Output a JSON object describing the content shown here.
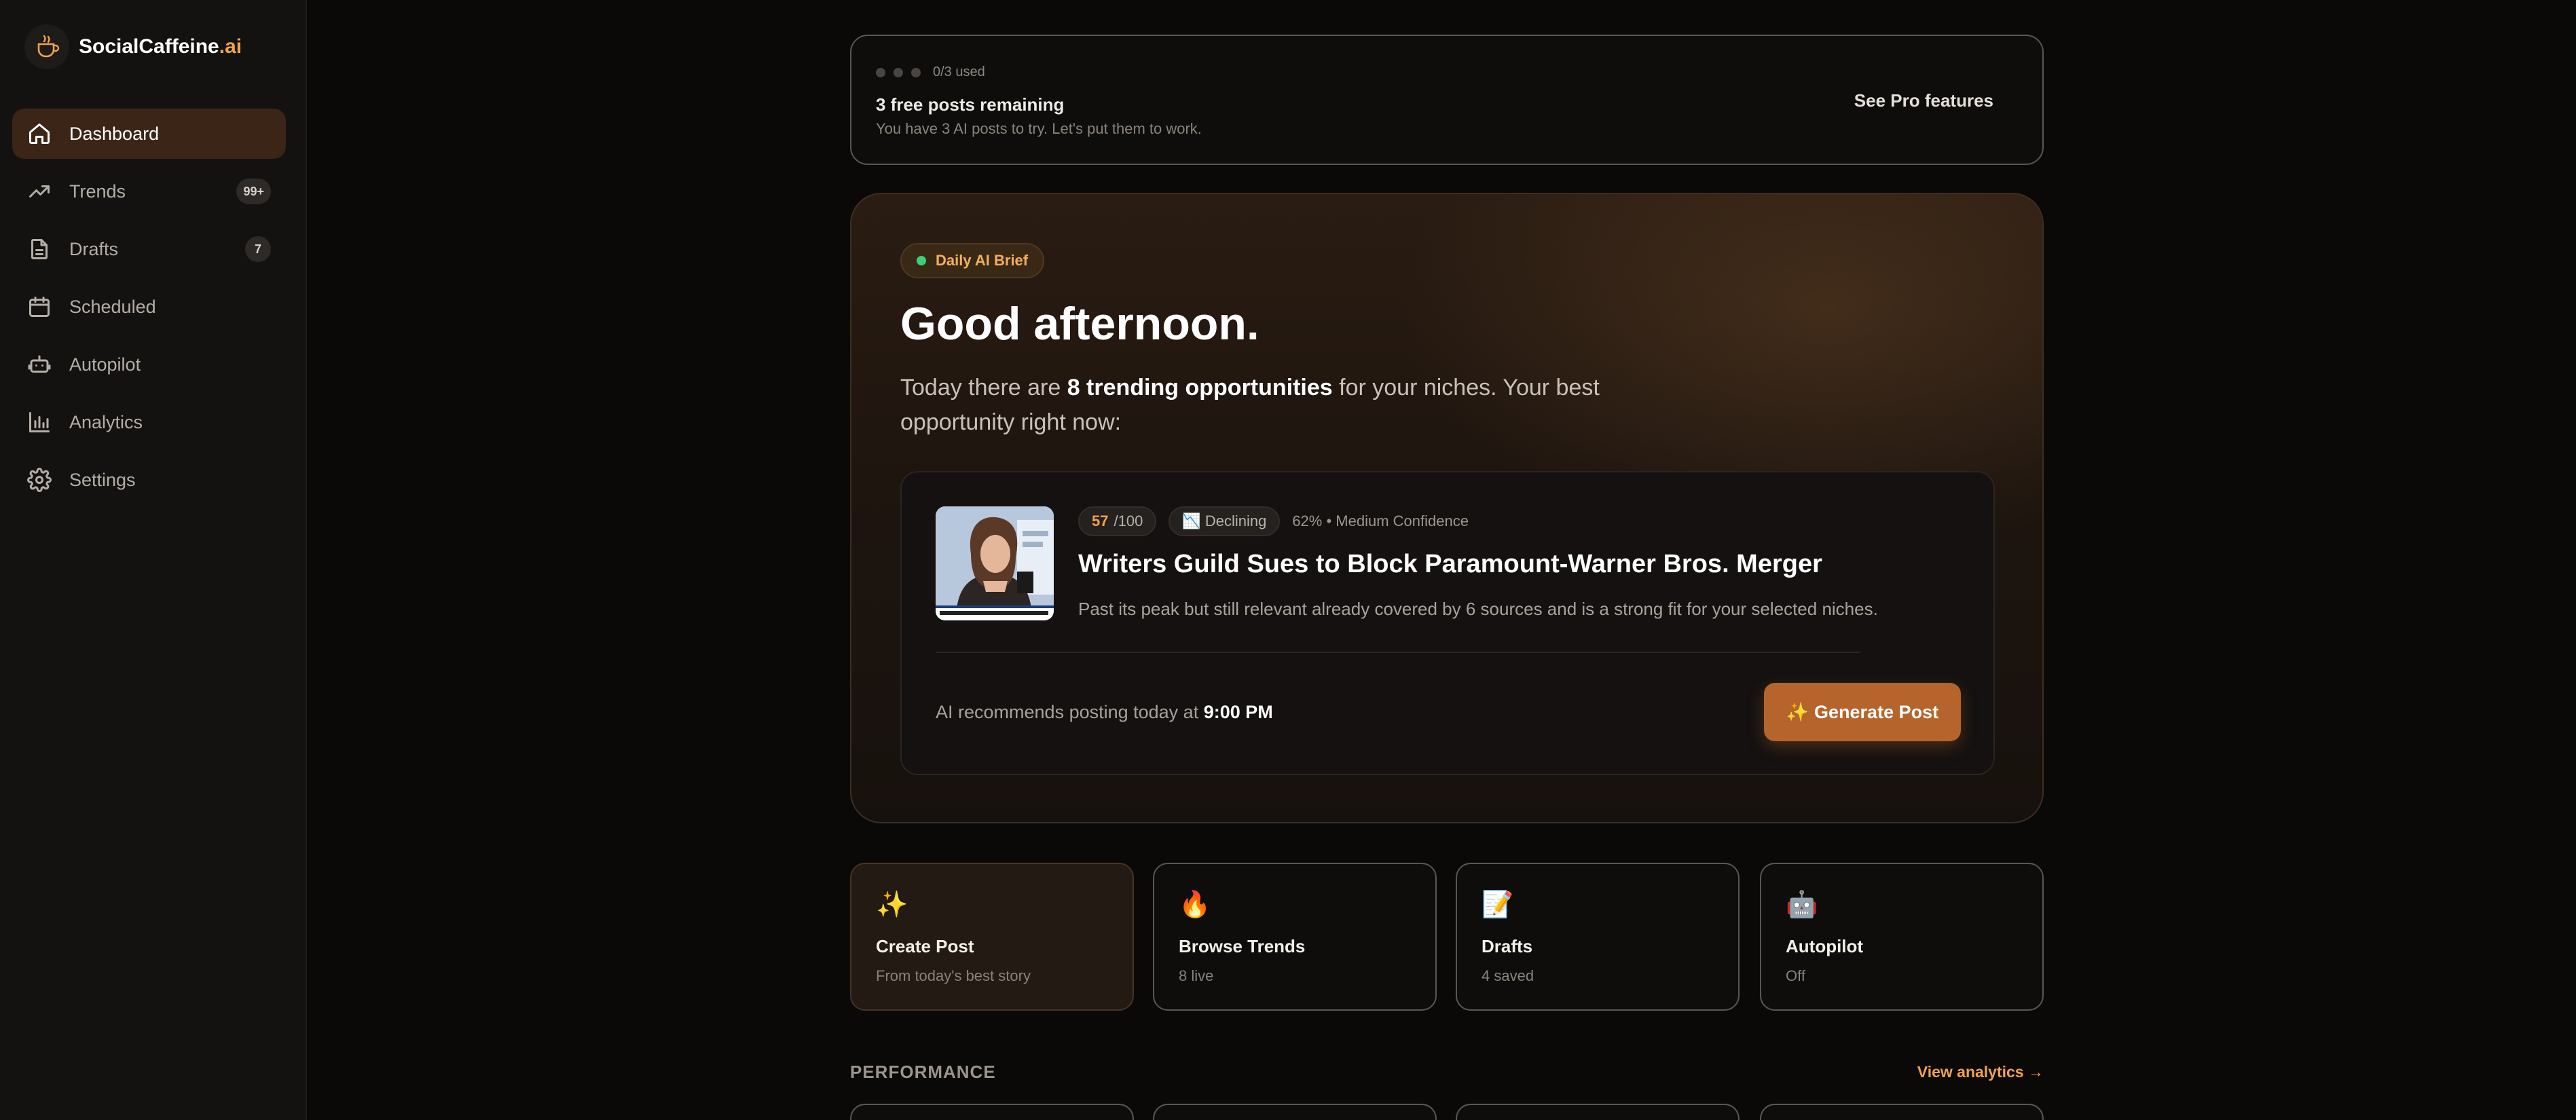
{
  "brand": {
    "name": "SocialCaffeine",
    "suffix": ".ai"
  },
  "sidebar": {
    "items": [
      {
        "label": "Dashboard",
        "icon": "home-icon",
        "active": true
      },
      {
        "label": "Trends",
        "icon": "trending-up-icon",
        "badge": "99+"
      },
      {
        "label": "Drafts",
        "icon": "document-icon",
        "badge": "7"
      },
      {
        "label": "Scheduled",
        "icon": "calendar-icon"
      },
      {
        "label": "Autopilot",
        "icon": "robot-icon"
      },
      {
        "label": "Analytics",
        "icon": "bar-chart-icon"
      },
      {
        "label": "Settings",
        "icon": "gear-icon"
      }
    ]
  },
  "usage": {
    "used_text": "0/3 used",
    "title": "3 free posts remaining",
    "subtitle": "You have 3 AI posts to try. Let's put them to work.",
    "pro_link": "See Pro features"
  },
  "brief": {
    "pill": "Daily AI Brief",
    "greeting": "Good afternoon.",
    "lead_pre": "Today there are ",
    "lead_bold": "8 trending opportunities",
    "lead_post": " for your niches. Your best opportunity right now:"
  },
  "opportunity": {
    "score": "57",
    "score_max": "/100",
    "trend": "📉 Declining",
    "confidence": "62% • Medium Confidence",
    "title": "Writers Guild Sues to Block Paramount-Warner Bros. Merger",
    "description": "Past its peak but still relevant already covered by 6 sources and is a strong fit for your selected niches.",
    "rec_pre": "AI recommends posting today at ",
    "rec_time": "9:00 PM",
    "cta": "✨ Generate Post"
  },
  "quick_actions": [
    {
      "icon": "✨",
      "title": "Create Post",
      "sub": "From today's best story"
    },
    {
      "icon": "🔥",
      "title": "Browse Trends",
      "sub": "8 live"
    },
    {
      "icon": "📝",
      "title": "Drafts",
      "sub": "4 saved"
    },
    {
      "icon": "🤖",
      "title": "Autopilot",
      "sub": "Off"
    }
  ],
  "performance": {
    "label": "PERFORMANCE",
    "link": "View analytics →"
  },
  "colors": {
    "accent": "#f0a250",
    "button": "#b5642c",
    "live_dot": "#3ccf7a"
  }
}
